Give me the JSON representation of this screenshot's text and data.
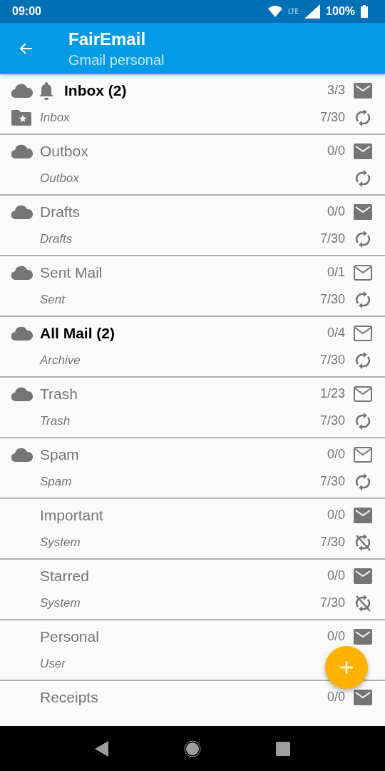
{
  "status_bar": {
    "time": "09:00",
    "network": "LTE",
    "battery": "100%"
  },
  "app_bar": {
    "title": "FairEmail",
    "subtitle": "Gmail personal"
  },
  "folders": [
    {
      "name": "Inbox (2)",
      "unread": true,
      "synchronize": true,
      "notify": true,
      "folder_icon": true,
      "type": "Inbox",
      "counts": "3/3",
      "envelope_filled": true,
      "messages": "7/30",
      "sync": true
    },
    {
      "name": "Outbox",
      "unread": false,
      "synchronize": true,
      "notify": false,
      "folder_icon": false,
      "type": "Outbox",
      "counts": "0/0",
      "envelope_filled": true,
      "sync": true
    },
    {
      "name": "Drafts",
      "unread": false,
      "synchronize": true,
      "notify": false,
      "folder_icon": false,
      "type": "Drafts",
      "counts": "0/0",
      "envelope_filled": true,
      "messages": "7/30",
      "sync": true
    },
    {
      "name": "Sent Mail",
      "unread": false,
      "synchronize": true,
      "notify": false,
      "folder_icon": false,
      "type": "Sent",
      "counts": "0/1",
      "envelope_filled": false,
      "messages": "7/30",
      "sync": true
    },
    {
      "name": "All Mail (2)",
      "unread": true,
      "synchronize": true,
      "notify": false,
      "folder_icon": false,
      "type": "Archive",
      "counts": "0/4",
      "envelope_filled": false,
      "messages": "7/30",
      "sync": true
    },
    {
      "name": "Trash",
      "unread": false,
      "synchronize": true,
      "notify": false,
      "folder_icon": false,
      "type": "Trash",
      "counts": "1/23",
      "envelope_filled": false,
      "messages": "7/30",
      "sync": true
    },
    {
      "name": "Spam",
      "unread": false,
      "synchronize": true,
      "notify": false,
      "folder_icon": false,
      "type": "Spam",
      "counts": "0/0",
      "envelope_filled": false,
      "messages": "7/30",
      "sync": true
    },
    {
      "name": "Important",
      "unread": false,
      "synchronize": false,
      "notify": false,
      "folder_icon": false,
      "type": "System",
      "counts": "0/0",
      "envelope_filled": true,
      "messages": "7/30",
      "sync": false
    },
    {
      "name": "Starred",
      "unread": false,
      "synchronize": false,
      "notify": false,
      "folder_icon": false,
      "type": "System",
      "counts": "0/0",
      "envelope_filled": true,
      "messages": "7/30",
      "sync": false
    },
    {
      "name": "Personal",
      "unread": false,
      "synchronize": false,
      "notify": false,
      "folder_icon": false,
      "type": "User",
      "counts": "0/0",
      "envelope_filled": true
    },
    {
      "name": "Receipts",
      "unread": false,
      "synchronize": false,
      "notify": false,
      "folder_icon": false,
      "counts": "0/0",
      "envelope_filled": true
    }
  ]
}
